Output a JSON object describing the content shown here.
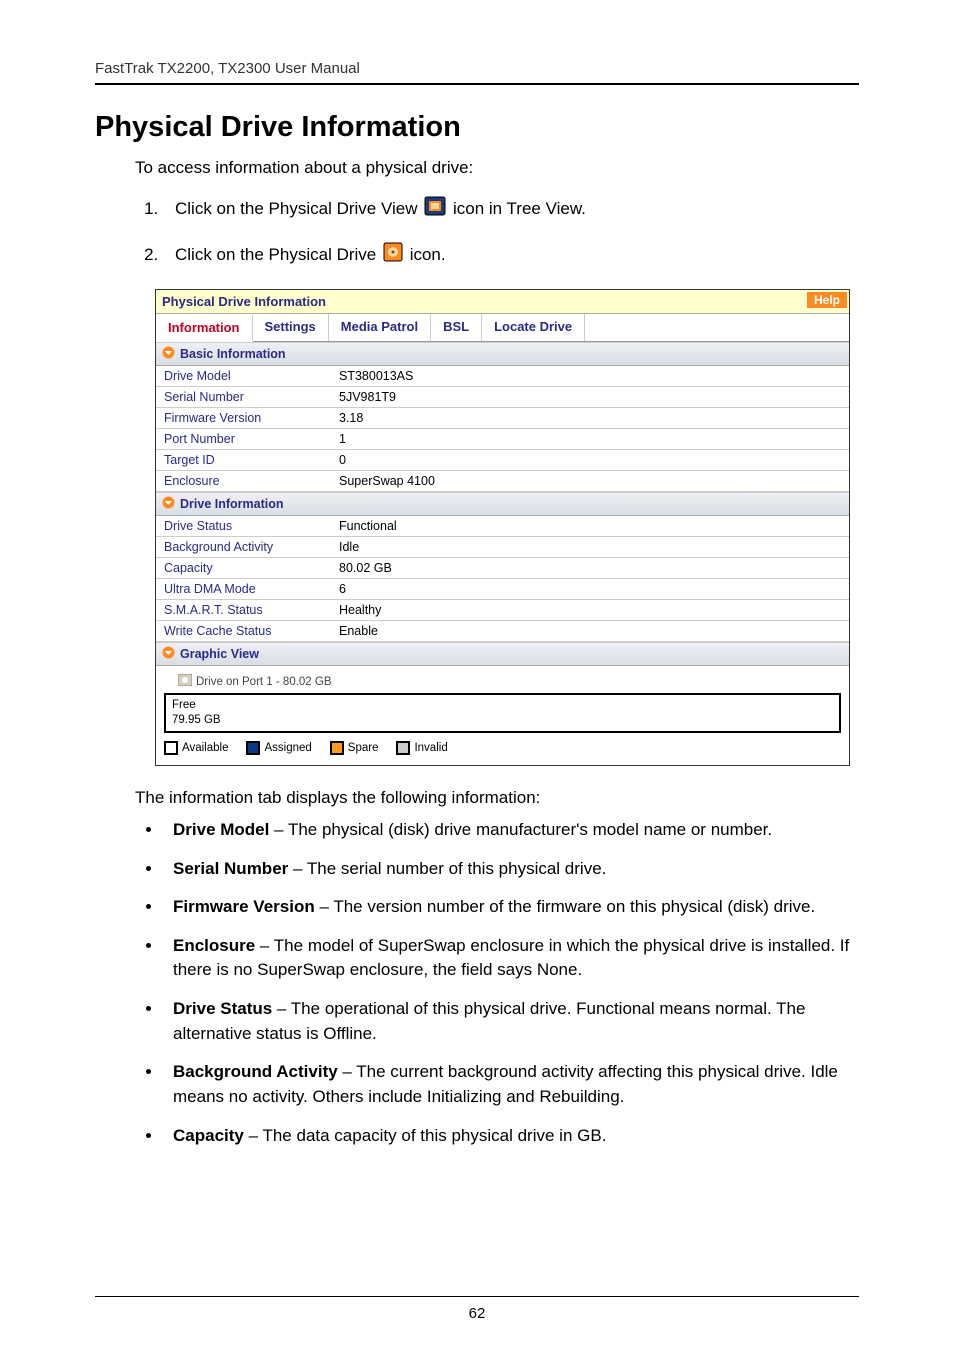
{
  "header": {
    "running": "FastTrak TX2200, TX2300 User Manual"
  },
  "title": "Physical Drive Information",
  "intro": "To access information about a physical drive:",
  "steps": {
    "s1a": "Click on the Physical Drive View ",
    "s1b": " icon in Tree View.",
    "s2a": "Click on the Physical Drive ",
    "s2b": " icon."
  },
  "screenshot": {
    "titlebar": "Physical Drive Information",
    "help": "Help",
    "tabs": {
      "info": "Information",
      "settings": "Settings",
      "media": "Media Patrol",
      "bsl": "BSL",
      "locate": "Locate Drive"
    },
    "sections": {
      "basic": "Basic Information",
      "drive": "Drive Information",
      "graphic": "Graphic View"
    },
    "basic": {
      "drive_model_k": "Drive Model",
      "drive_model_v": "ST380013AS",
      "serial_k": "Serial Number",
      "serial_v": "5JV981T9",
      "fw_k": "Firmware Version",
      "fw_v": "3.18",
      "port_k": "Port Number",
      "port_v": "1",
      "target_k": "Target ID",
      "target_v": "0",
      "encl_k": "Enclosure",
      "encl_v": "SuperSwap 4100"
    },
    "drive": {
      "status_k": "Drive Status",
      "status_v": "Functional",
      "bg_k": "Background Activity",
      "bg_v": "Idle",
      "cap_k": "Capacity",
      "cap_v": "80.02 GB",
      "udma_k": "Ultra DMA Mode",
      "udma_v": "6",
      "smart_k": "S.M.A.R.T. Status",
      "smart_v": "Healthy",
      "wcache_k": "Write Cache Status",
      "wcache_v": "Enable"
    },
    "graphic": {
      "drive_label": "Drive on Port 1 - 80.02 GB",
      "free_label": "Free",
      "free_size": "79.95 GB",
      "legend": {
        "available": "Available",
        "assigned": "Assigned",
        "spare": "Spare",
        "invalid": "Invalid"
      }
    }
  },
  "chart_data": {
    "type": "bar",
    "title": "Drive on Port 1 - 80.02 GB",
    "categories": [
      "Free"
    ],
    "values": [
      79.95
    ],
    "ylim": [
      0,
      80.02
    ],
    "ylabel": "GB"
  },
  "after": "The information tab displays the following information:",
  "bullets": {
    "b1_t": "Drive Model",
    "b1_d": " – The physical (disk) drive manufacturer's model name or number.",
    "b2_t": "Serial Number",
    "b2_d": " – The serial number of this physical drive.",
    "b3_t": "Firmware Version",
    "b3_d": " – The version number of the firmware on this physical (disk) drive.",
    "b4_t": "Enclosure",
    "b4_d": " – The model of SuperSwap enclosure in which the physical drive is installed. If there is no SuperSwap enclosure, the field says None.",
    "b5_t": "Drive Status",
    "b5_d": " – The operational of this physical drive. Functional means normal. The alternative status is Offline.",
    "b6_t": "Background Activity",
    "b6_d": " – The current background activity affecting this physical drive. Idle means no activity. Others include Initializing and Rebuilding.",
    "b7_t": "Capacity",
    "b7_d": " – The data capacity of this physical drive in GB."
  },
  "page_number": "62"
}
